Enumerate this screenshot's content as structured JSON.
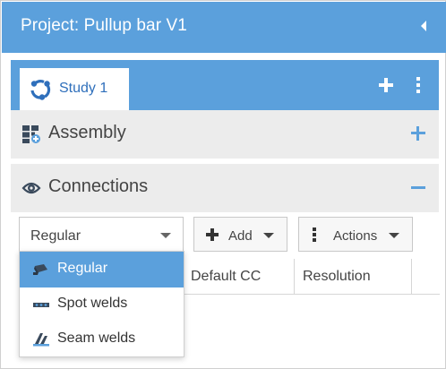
{
  "header": {
    "title": "Project: Pullup bar V1"
  },
  "study_tabs": [
    {
      "label": "Study 1"
    }
  ],
  "sections": {
    "assembly": {
      "label": "Assembly",
      "toggle": "expand"
    },
    "connections": {
      "label": "Connections",
      "toggle": "collapse"
    }
  },
  "toolbar": {
    "select_value": "Regular",
    "add_label": "Add",
    "actions_label": "Actions"
  },
  "table": {
    "columns": [
      "",
      "Default CC",
      "Resolution"
    ]
  },
  "dropdown": {
    "options": [
      {
        "label": "Regular",
        "icon": "regular-connector-icon",
        "selected": true
      },
      {
        "label": "Spot welds",
        "icon": "spot-weld-icon",
        "selected": false
      },
      {
        "label": "Seam welds",
        "icon": "seam-weld-icon",
        "selected": false
      }
    ]
  },
  "colors": {
    "accent": "#5ba0dc",
    "section_bg": "#ececec",
    "tab_text": "#2f6fbb"
  }
}
